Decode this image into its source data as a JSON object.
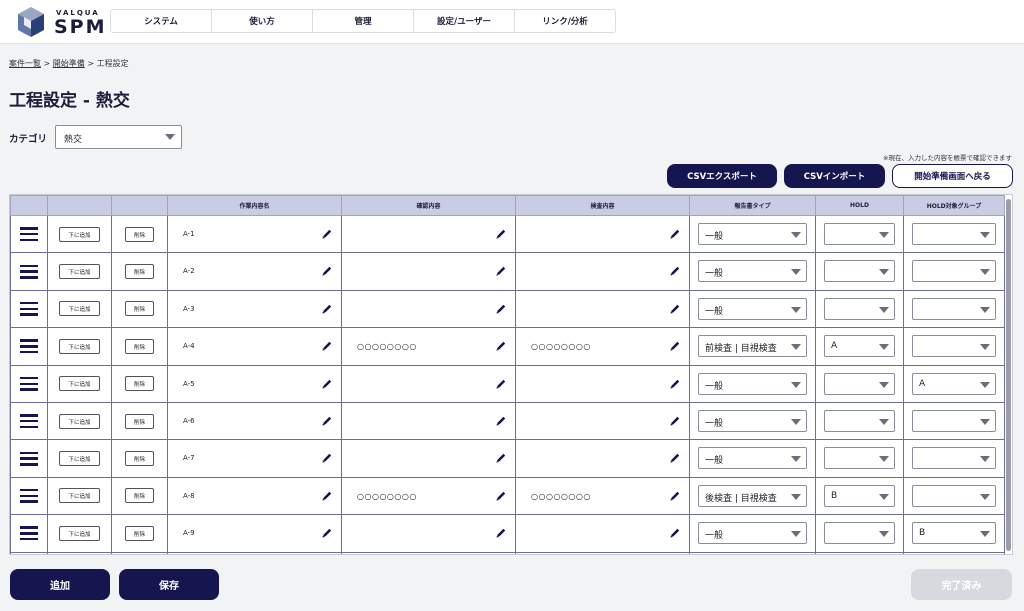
{
  "brand": {
    "small": "VALQUA",
    "big": "SPM"
  },
  "nav": [
    "システム",
    "使い方",
    "管理",
    "設定/ユーザー",
    "リンク/分析"
  ],
  "breadcrumb": {
    "item1": "案件一覧",
    "sep": " > ",
    "item2": "開始準備",
    "current": "工程設定"
  },
  "page_title": "工程設定 - 熱交",
  "category": {
    "label": "カテゴリ",
    "value": "熱交"
  },
  "note": "※現在、入力した内容を帳票で確認できます",
  "buttons": {
    "csv_export": "CSVエクスポート",
    "csv_import": "CSVインポート",
    "back": "開始準備画面へ戻る",
    "add": "追加",
    "save": "保存",
    "done": "完了済み"
  },
  "table": {
    "headers": [
      "",
      "",
      "",
      "作業内容名",
      "確認内容",
      "検査内容",
      "報告書タイプ",
      "HOLD",
      "HOLD対象グループ"
    ],
    "add_below_label": "下に追加",
    "delete_label": "削除",
    "rows": [
      {
        "name": "A-1",
        "check": "",
        "inspect": "",
        "report": "一般",
        "hold": "",
        "group": ""
      },
      {
        "name": "A-2",
        "check": "",
        "inspect": "",
        "report": "一般",
        "hold": "",
        "group": ""
      },
      {
        "name": "A-3",
        "check": "",
        "inspect": "",
        "report": "一般",
        "hold": "",
        "group": ""
      },
      {
        "name": "A-4",
        "check": "○○○○○○○○",
        "inspect": "○○○○○○○○",
        "report": "前検査 | 目視検査",
        "hold": "A",
        "group": ""
      },
      {
        "name": "A-5",
        "check": "",
        "inspect": "",
        "report": "一般",
        "hold": "",
        "group": "A"
      },
      {
        "name": "A-6",
        "check": "",
        "inspect": "",
        "report": "一般",
        "hold": "",
        "group": ""
      },
      {
        "name": "A-7",
        "check": "",
        "inspect": "",
        "report": "一般",
        "hold": "",
        "group": ""
      },
      {
        "name": "A-8",
        "check": "○○○○○○○○",
        "inspect": "○○○○○○○○",
        "report": "後検査 | 目視検査",
        "hold": "B",
        "group": ""
      },
      {
        "name": "A-9",
        "check": "",
        "inspect": "",
        "report": "一般",
        "hold": "",
        "group": "B"
      },
      {
        "name": "",
        "check": "",
        "inspect": "",
        "report": "",
        "hold": "",
        "group": ""
      }
    ]
  },
  "colors": {
    "primary": "#15164f",
    "header_bg": "#c9cde3",
    "disabled": "#d8d9de"
  },
  "icons": {
    "drag": "drag-handle-icon",
    "edit": "pencil-icon",
    "dropdown": "chevron-down-icon"
  }
}
